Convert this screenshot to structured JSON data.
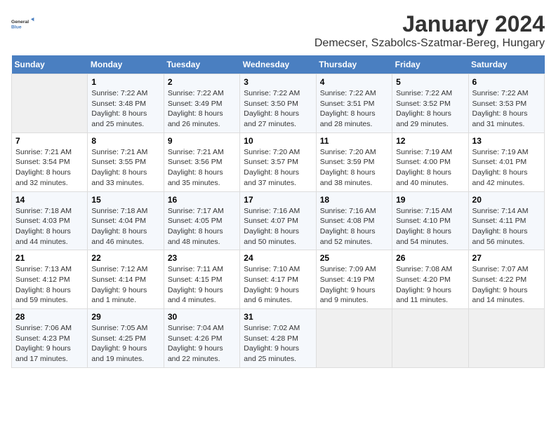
{
  "header": {
    "logo_line1": "General",
    "logo_line2": "Blue",
    "title": "January 2024",
    "subtitle": "Demecser, Szabolcs-Szatmar-Bereg, Hungary"
  },
  "days": [
    "Sunday",
    "Monday",
    "Tuesday",
    "Wednesday",
    "Thursday",
    "Friday",
    "Saturday"
  ],
  "weeks": [
    [
      {
        "date": "",
        "sunrise": "",
        "sunset": "",
        "daylight": ""
      },
      {
        "date": "1",
        "sunrise": "Sunrise: 7:22 AM",
        "sunset": "Sunset: 3:48 PM",
        "daylight": "Daylight: 8 hours and 25 minutes."
      },
      {
        "date": "2",
        "sunrise": "Sunrise: 7:22 AM",
        "sunset": "Sunset: 3:49 PM",
        "daylight": "Daylight: 8 hours and 26 minutes."
      },
      {
        "date": "3",
        "sunrise": "Sunrise: 7:22 AM",
        "sunset": "Sunset: 3:50 PM",
        "daylight": "Daylight: 8 hours and 27 minutes."
      },
      {
        "date": "4",
        "sunrise": "Sunrise: 7:22 AM",
        "sunset": "Sunset: 3:51 PM",
        "daylight": "Daylight: 8 hours and 28 minutes."
      },
      {
        "date": "5",
        "sunrise": "Sunrise: 7:22 AM",
        "sunset": "Sunset: 3:52 PM",
        "daylight": "Daylight: 8 hours and 29 minutes."
      },
      {
        "date": "6",
        "sunrise": "Sunrise: 7:22 AM",
        "sunset": "Sunset: 3:53 PM",
        "daylight": "Daylight: 8 hours and 31 minutes."
      }
    ],
    [
      {
        "date": "7",
        "sunrise": "Sunrise: 7:21 AM",
        "sunset": "Sunset: 3:54 PM",
        "daylight": "Daylight: 8 hours and 32 minutes."
      },
      {
        "date": "8",
        "sunrise": "Sunrise: 7:21 AM",
        "sunset": "Sunset: 3:55 PM",
        "daylight": "Daylight: 8 hours and 33 minutes."
      },
      {
        "date": "9",
        "sunrise": "Sunrise: 7:21 AM",
        "sunset": "Sunset: 3:56 PM",
        "daylight": "Daylight: 8 hours and 35 minutes."
      },
      {
        "date": "10",
        "sunrise": "Sunrise: 7:20 AM",
        "sunset": "Sunset: 3:57 PM",
        "daylight": "Daylight: 8 hours and 37 minutes."
      },
      {
        "date": "11",
        "sunrise": "Sunrise: 7:20 AM",
        "sunset": "Sunset: 3:59 PM",
        "daylight": "Daylight: 8 hours and 38 minutes."
      },
      {
        "date": "12",
        "sunrise": "Sunrise: 7:19 AM",
        "sunset": "Sunset: 4:00 PM",
        "daylight": "Daylight: 8 hours and 40 minutes."
      },
      {
        "date": "13",
        "sunrise": "Sunrise: 7:19 AM",
        "sunset": "Sunset: 4:01 PM",
        "daylight": "Daylight: 8 hours and 42 minutes."
      }
    ],
    [
      {
        "date": "14",
        "sunrise": "Sunrise: 7:18 AM",
        "sunset": "Sunset: 4:03 PM",
        "daylight": "Daylight: 8 hours and 44 minutes."
      },
      {
        "date": "15",
        "sunrise": "Sunrise: 7:18 AM",
        "sunset": "Sunset: 4:04 PM",
        "daylight": "Daylight: 8 hours and 46 minutes."
      },
      {
        "date": "16",
        "sunrise": "Sunrise: 7:17 AM",
        "sunset": "Sunset: 4:05 PM",
        "daylight": "Daylight: 8 hours and 48 minutes."
      },
      {
        "date": "17",
        "sunrise": "Sunrise: 7:16 AM",
        "sunset": "Sunset: 4:07 PM",
        "daylight": "Daylight: 8 hours and 50 minutes."
      },
      {
        "date": "18",
        "sunrise": "Sunrise: 7:16 AM",
        "sunset": "Sunset: 4:08 PM",
        "daylight": "Daylight: 8 hours and 52 minutes."
      },
      {
        "date": "19",
        "sunrise": "Sunrise: 7:15 AM",
        "sunset": "Sunset: 4:10 PM",
        "daylight": "Daylight: 8 hours and 54 minutes."
      },
      {
        "date": "20",
        "sunrise": "Sunrise: 7:14 AM",
        "sunset": "Sunset: 4:11 PM",
        "daylight": "Daylight: 8 hours and 56 minutes."
      }
    ],
    [
      {
        "date": "21",
        "sunrise": "Sunrise: 7:13 AM",
        "sunset": "Sunset: 4:12 PM",
        "daylight": "Daylight: 8 hours and 59 minutes."
      },
      {
        "date": "22",
        "sunrise": "Sunrise: 7:12 AM",
        "sunset": "Sunset: 4:14 PM",
        "daylight": "Daylight: 9 hours and 1 minute."
      },
      {
        "date": "23",
        "sunrise": "Sunrise: 7:11 AM",
        "sunset": "Sunset: 4:15 PM",
        "daylight": "Daylight: 9 hours and 4 minutes."
      },
      {
        "date": "24",
        "sunrise": "Sunrise: 7:10 AM",
        "sunset": "Sunset: 4:17 PM",
        "daylight": "Daylight: 9 hours and 6 minutes."
      },
      {
        "date": "25",
        "sunrise": "Sunrise: 7:09 AM",
        "sunset": "Sunset: 4:19 PM",
        "daylight": "Daylight: 9 hours and 9 minutes."
      },
      {
        "date": "26",
        "sunrise": "Sunrise: 7:08 AM",
        "sunset": "Sunset: 4:20 PM",
        "daylight": "Daylight: 9 hours and 11 minutes."
      },
      {
        "date": "27",
        "sunrise": "Sunrise: 7:07 AM",
        "sunset": "Sunset: 4:22 PM",
        "daylight": "Daylight: 9 hours and 14 minutes."
      }
    ],
    [
      {
        "date": "28",
        "sunrise": "Sunrise: 7:06 AM",
        "sunset": "Sunset: 4:23 PM",
        "daylight": "Daylight: 9 hours and 17 minutes."
      },
      {
        "date": "29",
        "sunrise": "Sunrise: 7:05 AM",
        "sunset": "Sunset: 4:25 PM",
        "daylight": "Daylight: 9 hours and 19 minutes."
      },
      {
        "date": "30",
        "sunrise": "Sunrise: 7:04 AM",
        "sunset": "Sunset: 4:26 PM",
        "daylight": "Daylight: 9 hours and 22 minutes."
      },
      {
        "date": "31",
        "sunrise": "Sunrise: 7:02 AM",
        "sunset": "Sunset: 4:28 PM",
        "daylight": "Daylight: 9 hours and 25 minutes."
      },
      {
        "date": "",
        "sunrise": "",
        "sunset": "",
        "daylight": ""
      },
      {
        "date": "",
        "sunrise": "",
        "sunset": "",
        "daylight": ""
      },
      {
        "date": "",
        "sunrise": "",
        "sunset": "",
        "daylight": ""
      }
    ]
  ]
}
